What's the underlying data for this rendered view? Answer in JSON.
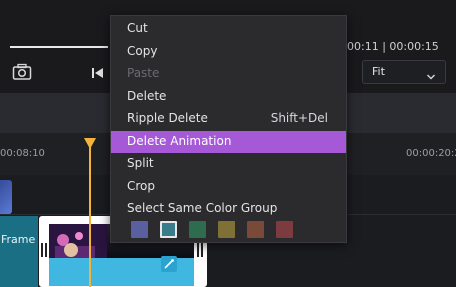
{
  "timecode": "00:11 | 00:00:15",
  "fit_select": {
    "label": "Fit"
  },
  "ruler": {
    "tick_left": "00:08:10",
    "tick_right": "00:00:20:2"
  },
  "clip": {
    "frame_label": "Frame"
  },
  "context_menu": {
    "items": [
      {
        "label": "Cut",
        "shortcut": "",
        "disabled": false
      },
      {
        "label": "Copy",
        "shortcut": "",
        "disabled": false
      },
      {
        "label": "Paste",
        "shortcut": "",
        "disabled": true
      },
      {
        "label": "Delete",
        "shortcut": "",
        "disabled": false
      },
      {
        "label": "Ripple Delete",
        "shortcut": "Shift+Del",
        "disabled": false
      },
      {
        "label": "Delete Animation",
        "shortcut": "",
        "disabled": false,
        "highlighted": true
      },
      {
        "label": "Split",
        "shortcut": "",
        "disabled": false
      },
      {
        "label": "Crop",
        "shortcut": "",
        "disabled": false
      }
    ],
    "color_group_label": "Select Same Color Group",
    "swatches": [
      "#5a5f9f",
      "#3b7c8a",
      "#2f6b4f",
      "#7e7036",
      "#7a4a38",
      "#7b3b3f"
    ],
    "selected_swatch_index": 1
  },
  "colors": {
    "highlight": "#a659d6",
    "playhead": "#f2b53a",
    "clip_accent": "#3fb7e0"
  },
  "icons": [
    "camera-icon",
    "previous-frame-icon",
    "chevron-down-icon",
    "playhead-marker-icon",
    "clip-handle-icon",
    "magic-wand-icon"
  ]
}
